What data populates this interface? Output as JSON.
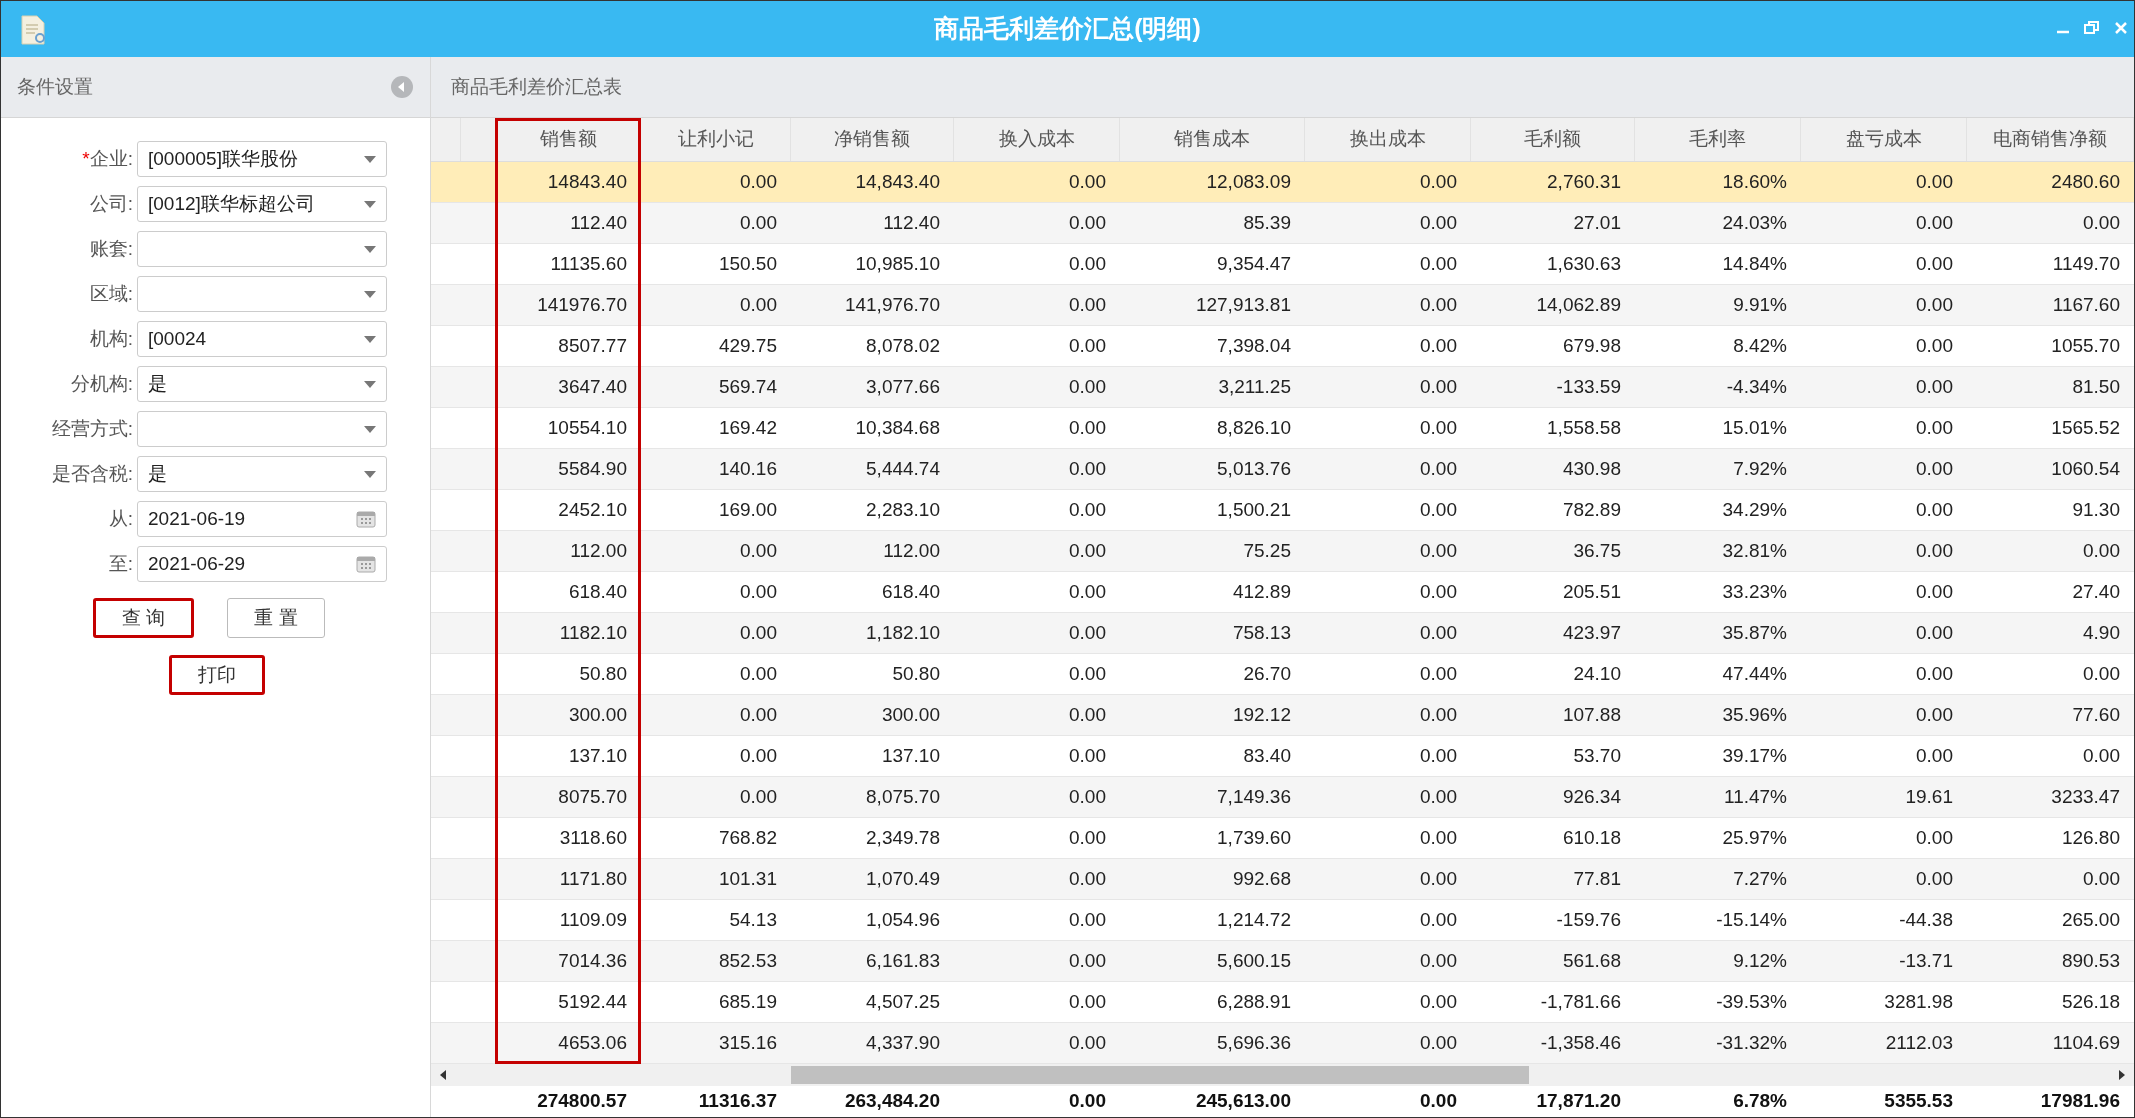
{
  "window": {
    "title": "商品毛利差价汇总(明细)"
  },
  "sidebar": {
    "title": "条件设置",
    "fields": [
      {
        "label": "企业:",
        "required_mark": "*",
        "kind": "select",
        "value": "[000005]联华股份"
      },
      {
        "label": "公司:",
        "kind": "select",
        "value": "[0012]联华标超公司"
      },
      {
        "label": "账套:",
        "kind": "select"
      },
      {
        "label": "区域:",
        "kind": "select"
      },
      {
        "label": "机构:",
        "kind": "select",
        "value": "[00024"
      },
      {
        "label": "分机构:",
        "kind": "select",
        "value": "是"
      },
      {
        "label": "经营方式:",
        "kind": "select"
      },
      {
        "label": "是否含税:",
        "kind": "select",
        "value": "是"
      },
      {
        "label": "从:",
        "kind": "date",
        "value": "2021-06-19"
      },
      {
        "label": "至:",
        "kind": "date",
        "value": "2021-06-29"
      }
    ],
    "buttons": [
      {
        "label": "查 询",
        "highlighted": true
      },
      {
        "label": "重 置",
        "highlighted": false
      },
      {
        "label": "打印",
        "highlighted": true
      }
    ]
  },
  "table": {
    "caption": "商品毛利差价汇总表",
    "columns": [
      {
        "label": "销售额",
        "highlighted": true
      },
      {
        "label": "让利小记",
        "highlighted": false
      },
      {
        "label": "净销售额",
        "highlighted": false
      },
      {
        "label": "换入成本",
        "highlighted": false
      },
      {
        "label": "销售成本",
        "highlighted": false
      },
      {
        "label": "换出成本",
        "highlighted": false
      },
      {
        "label": "毛利额",
        "highlighted": false
      },
      {
        "label": "毛利率",
        "highlighted": false
      },
      {
        "label": "盘亏成本",
        "highlighted": false
      },
      {
        "label": "电商销售净额",
        "highlighted": false
      }
    ],
    "rows": [
      {
        "selected": true,
        "cells": [
          "14843.40",
          "0.00",
          "14,843.40",
          "0.00",
          "12,083.09",
          "0.00",
          "2,760.31",
          "18.60%",
          "0.00",
          "2480.60"
        ]
      },
      {
        "selected": false,
        "cells": [
          "112.40",
          "0.00",
          "112.40",
          "0.00",
          "85.39",
          "0.00",
          "27.01",
          "24.03%",
          "0.00",
          "0.00"
        ]
      },
      {
        "selected": false,
        "cells": [
          "11135.60",
          "150.50",
          "10,985.10",
          "0.00",
          "9,354.47",
          "0.00",
          "1,630.63",
          "14.84%",
          "0.00",
          "1149.70"
        ]
      },
      {
        "selected": false,
        "cells": [
          "141976.70",
          "0.00",
          "141,976.70",
          "0.00",
          "127,913.81",
          "0.00",
          "14,062.89",
          "9.91%",
          "0.00",
          "1167.60"
        ]
      },
      {
        "selected": false,
        "cells": [
          "8507.77",
          "429.75",
          "8,078.02",
          "0.00",
          "7,398.04",
          "0.00",
          "679.98",
          "8.42%",
          "0.00",
          "1055.70"
        ]
      },
      {
        "selected": false,
        "cells": [
          "3647.40",
          "569.74",
          "3,077.66",
          "0.00",
          "3,211.25",
          "0.00",
          "-133.59",
          "-4.34%",
          "0.00",
          "81.50"
        ]
      },
      {
        "selected": false,
        "cells": [
          "10554.10",
          "169.42",
          "10,384.68",
          "0.00",
          "8,826.10",
          "0.00",
          "1,558.58",
          "15.01%",
          "0.00",
          "1565.52"
        ]
      },
      {
        "selected": false,
        "cells": [
          "5584.90",
          "140.16",
          "5,444.74",
          "0.00",
          "5,013.76",
          "0.00",
          "430.98",
          "7.92%",
          "0.00",
          "1060.54"
        ]
      },
      {
        "selected": false,
        "cells": [
          "2452.10",
          "169.00",
          "2,283.10",
          "0.00",
          "1,500.21",
          "0.00",
          "782.89",
          "34.29%",
          "0.00",
          "91.30"
        ]
      },
      {
        "selected": false,
        "cells": [
          "112.00",
          "0.00",
          "112.00",
          "0.00",
          "75.25",
          "0.00",
          "36.75",
          "32.81%",
          "0.00",
          "0.00"
        ]
      },
      {
        "selected": false,
        "cells": [
          "618.40",
          "0.00",
          "618.40",
          "0.00",
          "412.89",
          "0.00",
          "205.51",
          "33.23%",
          "0.00",
          "27.40"
        ]
      },
      {
        "selected": false,
        "cells": [
          "1182.10",
          "0.00",
          "1,182.10",
          "0.00",
          "758.13",
          "0.00",
          "423.97",
          "35.87%",
          "0.00",
          "4.90"
        ]
      },
      {
        "selected": false,
        "cells": [
          "50.80",
          "0.00",
          "50.80",
          "0.00",
          "26.70",
          "0.00",
          "24.10",
          "47.44%",
          "0.00",
          "0.00"
        ]
      },
      {
        "selected": false,
        "cells": [
          "300.00",
          "0.00",
          "300.00",
          "0.00",
          "192.12",
          "0.00",
          "107.88",
          "35.96%",
          "0.00",
          "77.60"
        ]
      },
      {
        "selected": false,
        "cells": [
          "137.10",
          "0.00",
          "137.10",
          "0.00",
          "83.40",
          "0.00",
          "53.70",
          "39.17%",
          "0.00",
          "0.00"
        ]
      },
      {
        "selected": false,
        "cells": [
          "8075.70",
          "0.00",
          "8,075.70",
          "0.00",
          "7,149.36",
          "0.00",
          "926.34",
          "11.47%",
          "19.61",
          "3233.47"
        ]
      },
      {
        "selected": false,
        "cells": [
          "3118.60",
          "768.82",
          "2,349.78",
          "0.00",
          "1,739.60",
          "0.00",
          "610.18",
          "25.97%",
          "0.00",
          "126.80"
        ]
      },
      {
        "selected": false,
        "cells": [
          "1171.80",
          "101.31",
          "1,070.49",
          "0.00",
          "992.68",
          "0.00",
          "77.81",
          "7.27%",
          "0.00",
          "0.00"
        ]
      },
      {
        "selected": false,
        "cells": [
          "1109.09",
          "54.13",
          "1,054.96",
          "0.00",
          "1,214.72",
          "0.00",
          "-159.76",
          "-15.14%",
          "-44.38",
          "265.00"
        ]
      },
      {
        "selected": false,
        "cells": [
          "7014.36",
          "852.53",
          "6,161.83",
          "0.00",
          "5,600.15",
          "0.00",
          "561.68",
          "9.12%",
          "-13.71",
          "890.53"
        ]
      },
      {
        "selected": false,
        "cells": [
          "5192.44",
          "685.19",
          "4,507.25",
          "0.00",
          "6,288.91",
          "0.00",
          "-1,781.66",
          "-39.53%",
          "3281.98",
          "526.18"
        ]
      },
      {
        "selected": false,
        "cells": [
          "4653.06",
          "315.16",
          "4,337.90",
          "0.00",
          "5,696.36",
          "0.00",
          "-1,358.46",
          "-31.32%",
          "2112.03",
          "1104.69"
        ]
      }
    ],
    "totals": [
      "274800.57",
      "11316.37",
      "263,484.20",
      "0.00",
      "245,613.00",
      "0.00",
      "17,871.20",
      "6.78%",
      "5355.53",
      "17981.96"
    ]
  }
}
